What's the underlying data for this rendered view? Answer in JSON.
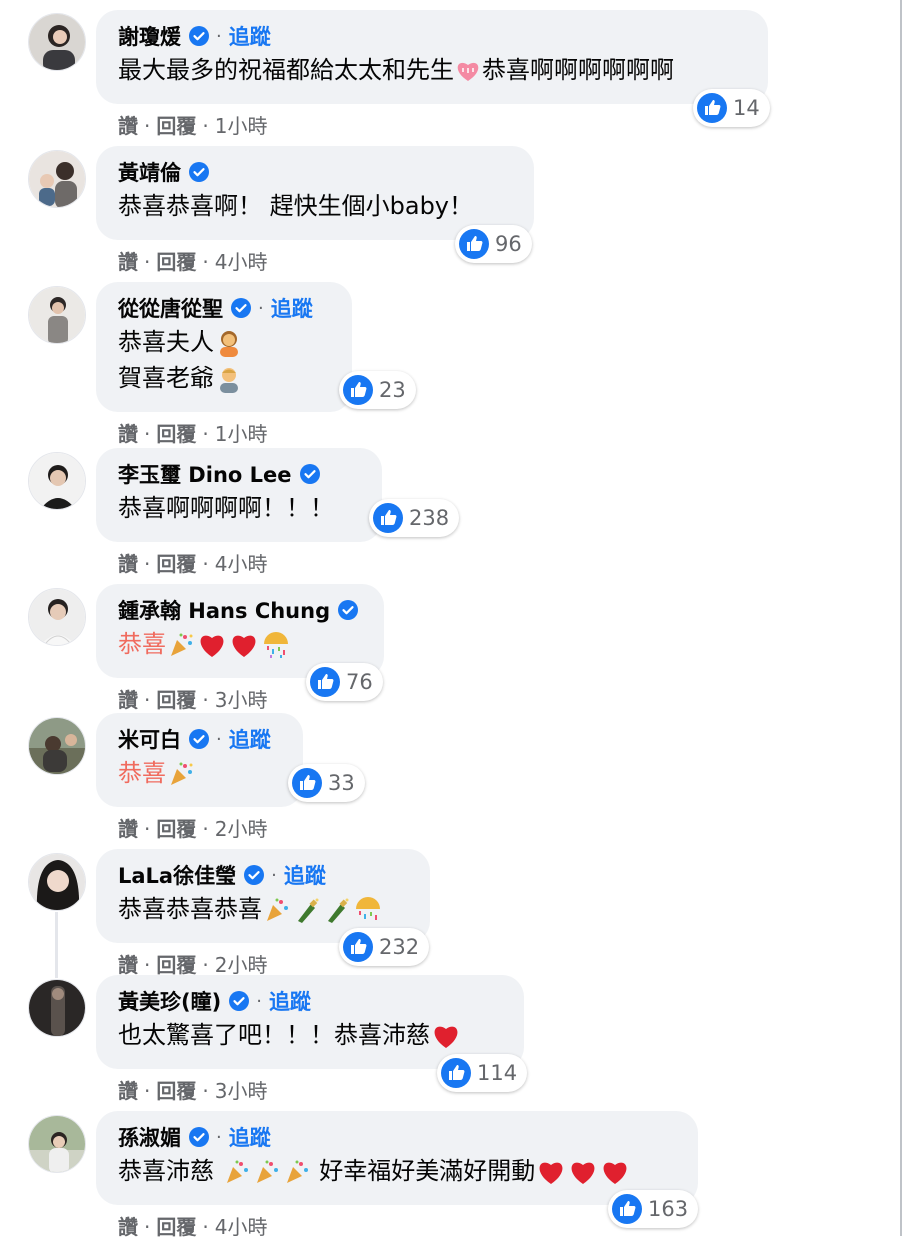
{
  "ui": {
    "action_like": "讚",
    "action_reply": "回覆",
    "dot": "·",
    "follow": "追蹤",
    "colors": {
      "accent": "#1877f2",
      "bubble": "#f0f2f5",
      "meta": "#65676b",
      "highlight_text": "#f06b5e"
    },
    "icons": {
      "verified": "verified-badge-icon",
      "like": "like-thumb-icon"
    }
  },
  "comments": [
    {
      "author": "謝瓊煖",
      "follow": true,
      "lines": [
        "最大最多的祝福都給太太和先生"
      ],
      "line_suffix": [
        "恭喜啊啊啊啊啊啊"
      ],
      "likes": "14",
      "time": "1小時"
    },
    {
      "author": "黃靖倫",
      "follow": false,
      "lines": [
        "恭喜恭喜啊！ 趕快生個小baby！"
      ],
      "likes": "96",
      "time": "4小時"
    },
    {
      "author": "從從唐從聖",
      "follow": true,
      "lines": [
        "恭喜夫人",
        "賀喜老爺"
      ],
      "likes": "23",
      "time": "1小時"
    },
    {
      "author": "李玉璽 Dino Lee",
      "follow": false,
      "lines": [
        "恭喜啊啊啊啊！！！"
      ],
      "likes": "238",
      "time": "4小時"
    },
    {
      "author": "鍾承翰 Hans Chung",
      "follow": false,
      "lines": [
        "恭喜"
      ],
      "likes": "76",
      "time": "3小時"
    },
    {
      "author": "米可白",
      "follow": true,
      "lines": [
        "恭喜"
      ],
      "likes": "33",
      "time": "2小時"
    },
    {
      "author": "LaLa徐佳瑩",
      "follow": true,
      "lines": [
        "恭喜恭喜恭喜"
      ],
      "likes": "232",
      "time": "2小時"
    },
    {
      "author": "黃美珍(瞳)",
      "follow": true,
      "lines": [
        "也太驚喜了吧！！！恭喜沛慈"
      ],
      "likes": "114",
      "time": "3小時"
    },
    {
      "author": "孫淑媚",
      "follow": true,
      "lines": [
        "恭喜沛慈"
      ],
      "line_suffix": [
        "好幸福好美滿好開動"
      ],
      "likes": "163",
      "time": "4小時"
    }
  ]
}
